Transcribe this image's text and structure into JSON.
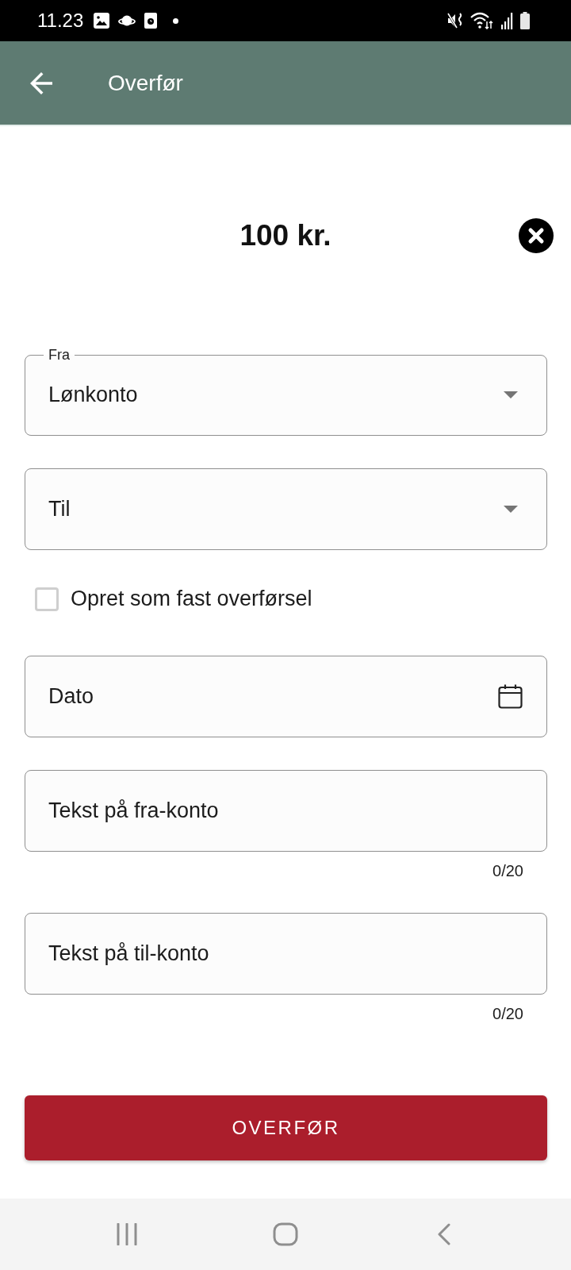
{
  "status_bar": {
    "time": "11.23"
  },
  "app_bar": {
    "title": "Overfør"
  },
  "amount": {
    "text": "100 kr."
  },
  "fields": [
    {
      "kind": "dropdown",
      "label": "Fra",
      "value": "Lønkonto"
    },
    {
      "kind": "dropdown",
      "label": "Til"
    },
    {
      "kind": "checkbox",
      "label": "Opret som fast overførsel",
      "checked": false
    },
    {
      "kind": "date",
      "label": "Dato"
    },
    {
      "kind": "text",
      "label": "Tekst på fra-konto",
      "counter": "0/20"
    },
    {
      "kind": "text",
      "label": "Tekst på til-konto",
      "counter": "0/20"
    }
  ],
  "submit_button": {
    "label": "OVERFØR"
  }
}
